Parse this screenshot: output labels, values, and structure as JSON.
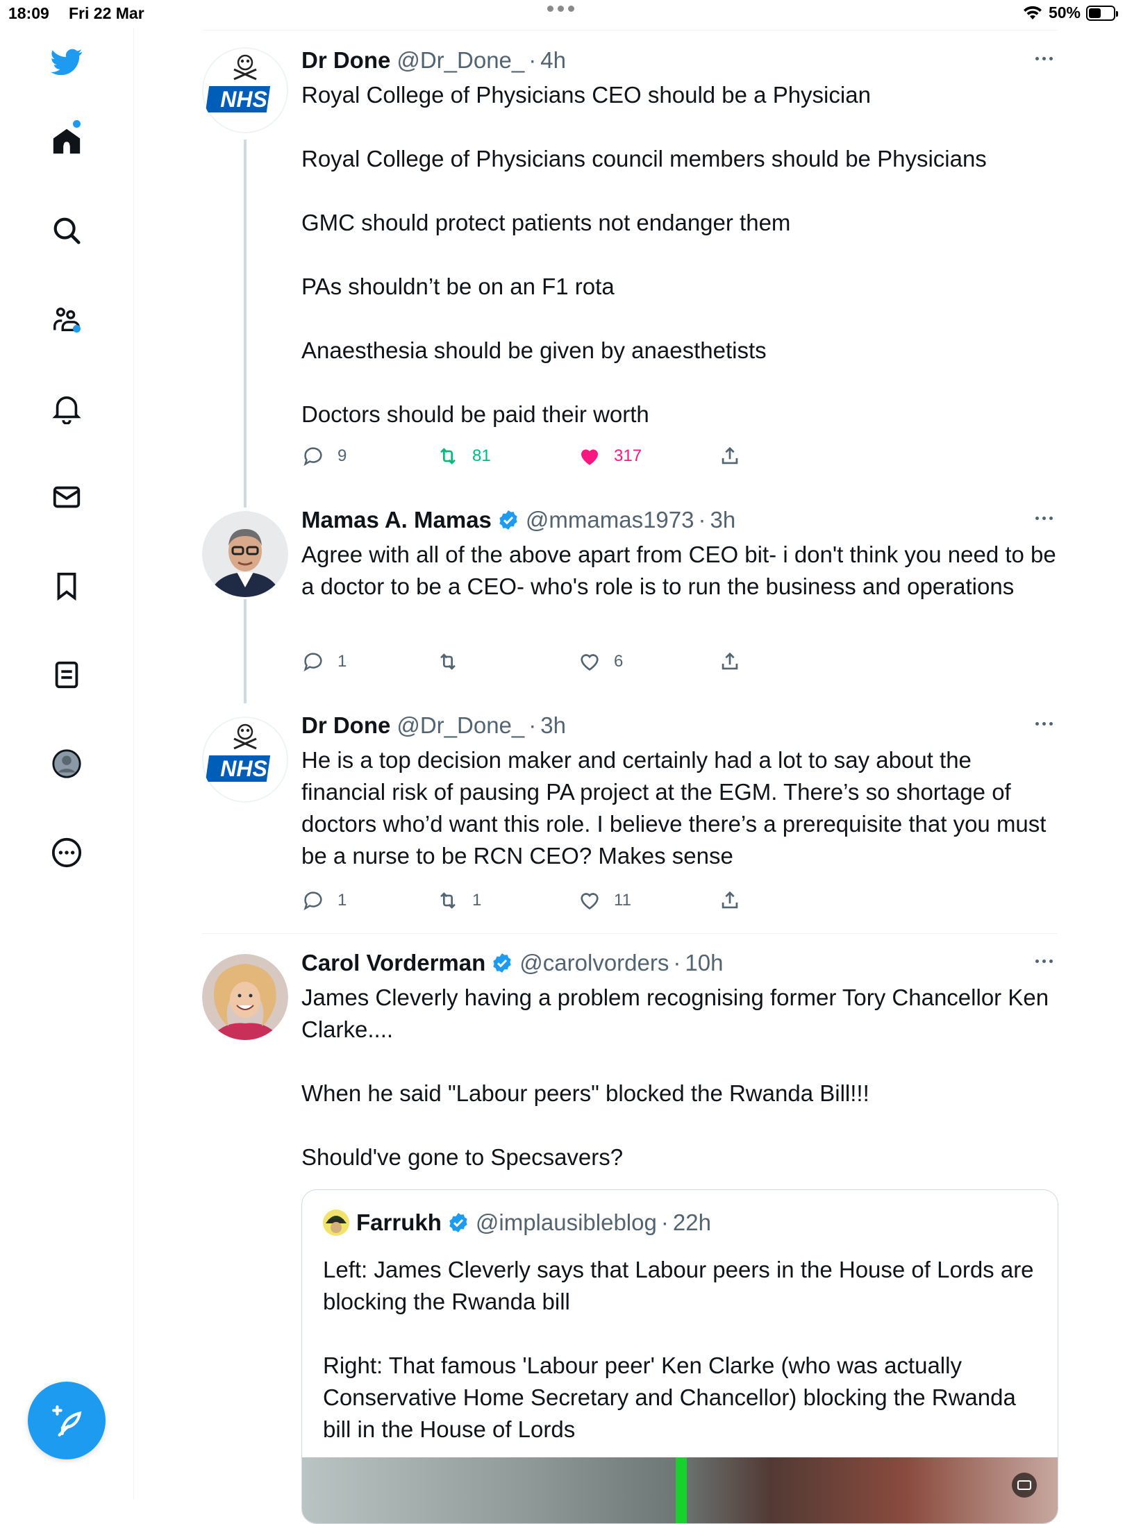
{
  "status_bar": {
    "time": "18:09",
    "date": "Fri 22 Mar",
    "battery": "50%",
    "battery_level": 0.5
  },
  "sidebar": {
    "items": [
      {
        "name": "twitter-bird-icon"
      },
      {
        "name": "home-icon",
        "badge": true
      },
      {
        "name": "search-icon"
      },
      {
        "name": "communities-icon",
        "badge": true
      },
      {
        "name": "notifications-bell-icon"
      },
      {
        "name": "messages-envelope-icon"
      },
      {
        "name": "bookmarks-icon"
      },
      {
        "name": "lists-icon"
      },
      {
        "name": "profile-icon"
      },
      {
        "name": "more-circle-icon"
      }
    ],
    "compose": {
      "name": "compose-tweet-icon"
    }
  },
  "tweets": [
    {
      "name": "Dr Done",
      "handle": "@Dr_Done_",
      "time": "4h",
      "verified": false,
      "text": "Royal College of Physicians CEO should be a Physician\n\nRoyal College of Physicians council members should be Physicians\n\nGMC should protect patients not endanger them\n\nPAs shouldn’t be on an F1 rota\n\nAnaesthesia should be given by anaesthetists\n\nDoctors should be paid their worth",
      "replies": "9",
      "retweets": "81",
      "likes": "317",
      "liked": true,
      "retweeted": true
    },
    {
      "name": "Mamas A. Mamas",
      "handle": "@mmamas1973",
      "time": "3h",
      "verified": true,
      "text": "Agree with all of the above apart from CEO bit- i don't think you need to be a doctor to be a CEO- who's role is to run the business and operations",
      "replies": "1",
      "retweets": "",
      "likes": "6"
    },
    {
      "name": "Dr Done",
      "handle": "@Dr_Done_",
      "time": "3h",
      "verified": false,
      "text": "He is a top decision maker and certainly had a lot to say about the financial risk of pausing PA project at the EGM. There’s so shortage of doctors who’d want this role. I believe there’s a prerequisite that you must be a nurse to be RCN CEO? Makes sense",
      "replies": "1",
      "retweets": "1",
      "likes": "11"
    },
    {
      "name": "Carol Vorderman",
      "handle": "@carolvorders",
      "time": "10h",
      "verified": true,
      "text": "James Cleverly having a problem recognising former Tory Chancellor Ken Clarke....\n\nWhen he said \"Labour peers\" blocked the Rwanda Bill!!!\n\nShould've gone to Specsavers?",
      "quote": {
        "name": "Farrukh",
        "handle": "@implausibleblog",
        "time": "22h",
        "verified": true,
        "text": "Left: James Cleverly says that Labour peers in the House of Lords are blocking the Rwanda bill\n\nRight: That famous 'Labour peer' Ken Clarke (who was actually Conservative Home Secretary and Chancellor) blocking the Rwanda bill in the House of Lords"
      }
    }
  ],
  "nhs_logo_text": "NHS",
  "colors": {
    "accent": "#1d9bf0",
    "like": "#f91880",
    "retweet": "#00ba7c",
    "secondary_text": "#536471"
  }
}
